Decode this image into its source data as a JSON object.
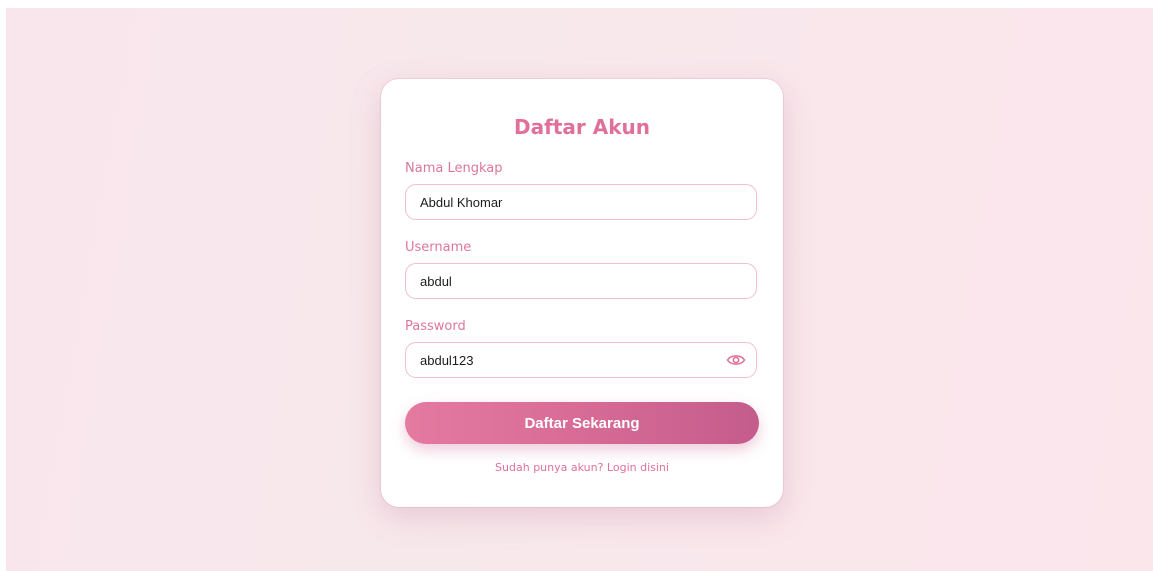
{
  "form": {
    "title": "Daftar Akun",
    "fields": [
      {
        "label": "Nama Lengkap",
        "value": "Abdul Khomar"
      },
      {
        "label": "Username",
        "value": "abdul"
      },
      {
        "label": "Password",
        "value": "abdul123"
      }
    ],
    "password_toggle_icon": "eye-icon",
    "submit_label": "Daftar Sekarang",
    "login_link": "Sudah punya akun? Login disini"
  },
  "colors": {
    "accent": "#e0709a",
    "button_start": "#e47aa0",
    "button_end": "#c45c8c",
    "field_border": "#efbfd0",
    "background": "#f9e6ec"
  }
}
